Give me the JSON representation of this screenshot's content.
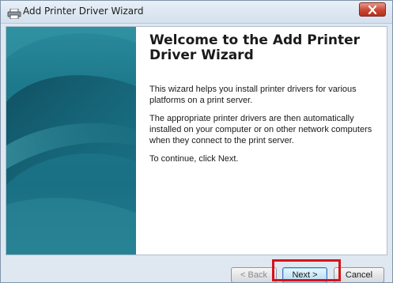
{
  "window": {
    "title": "Add Printer Driver Wizard",
    "icon": "printer-icon"
  },
  "wizard": {
    "heading": "Welcome to the Add Printer Driver Wizard",
    "paragraphs": [
      "This wizard helps you install printer drivers for various platforms on a print server.",
      "The appropriate printer drivers are then automatically installed on your computer or on other network computers when they connect to the print server.",
      "To continue, click Next."
    ]
  },
  "buttons": {
    "back": "< Back",
    "back_accel": "B",
    "next": "Next >",
    "cancel": "Cancel"
  },
  "colors": {
    "banner_primary": "#1f7c8e",
    "banner_dark": "#0f4e60",
    "highlight": "#d3141c",
    "close_button": "#c94733"
  }
}
